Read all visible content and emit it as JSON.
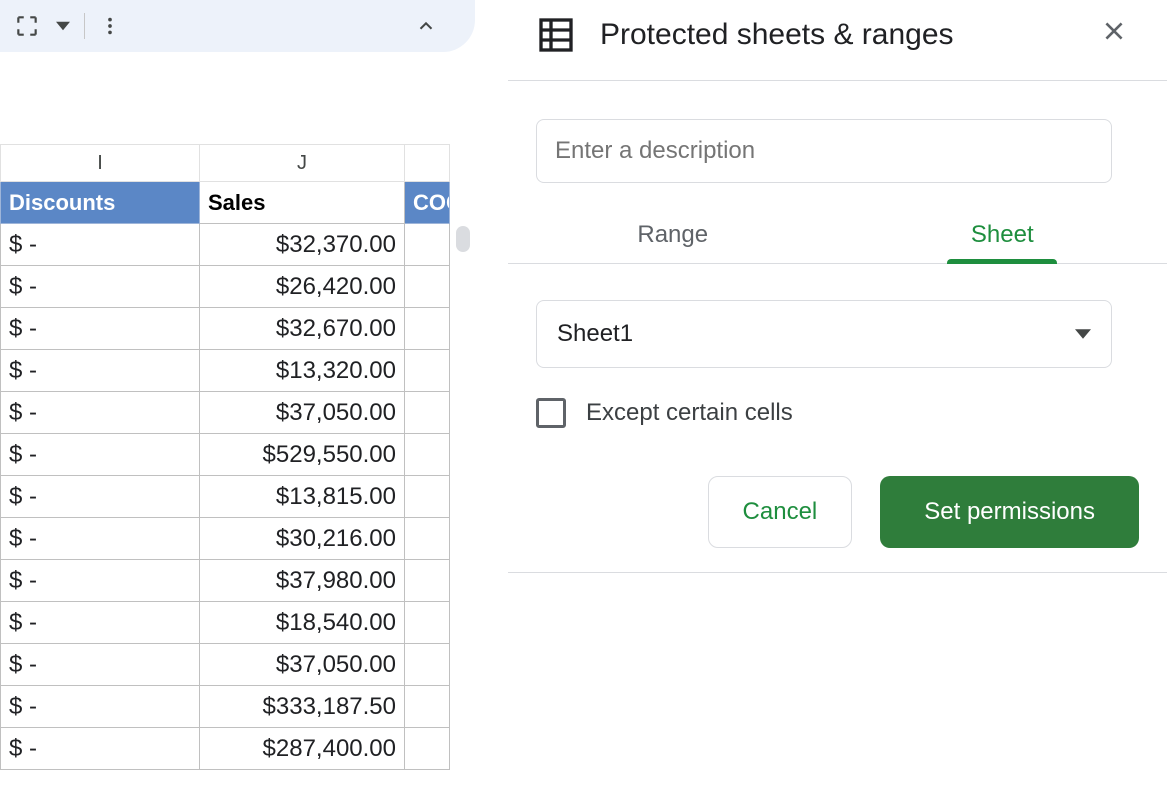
{
  "colLetters": {
    "I": "I",
    "J": "J"
  },
  "headers": {
    "discounts": "Discounts",
    "sales": "Sales",
    "cogs": "COGS"
  },
  "rows": [
    {
      "disc": "$ -",
      "sales": "$32,370.00"
    },
    {
      "disc": "$ -",
      "sales": "$26,420.00"
    },
    {
      "disc": "$ -",
      "sales": "$32,670.00"
    },
    {
      "disc": "$ -",
      "sales": "$13,320.00"
    },
    {
      "disc": "$ -",
      "sales": "$37,050.00"
    },
    {
      "disc": "$ -",
      "sales": "$529,550.00"
    },
    {
      "disc": "$ -",
      "sales": "$13,815.00"
    },
    {
      "disc": "$ -",
      "sales": "$30,216.00"
    },
    {
      "disc": "$ -",
      "sales": "$37,980.00"
    },
    {
      "disc": "$ -",
      "sales": "$18,540.00"
    },
    {
      "disc": "$ -",
      "sales": "$37,050.00"
    },
    {
      "disc": "$ -",
      "sales": "$333,187.50"
    },
    {
      "disc": "$ -",
      "sales": "$287,400.00"
    }
  ],
  "panel": {
    "title": "Protected sheets & ranges",
    "descPlaceholder": "Enter a description",
    "tabRange": "Range",
    "tabSheet": "Sheet",
    "sheetSelected": "Sheet1",
    "exceptLabel": "Except certain cells",
    "cancel": "Cancel",
    "setPerm": "Set permissions"
  }
}
